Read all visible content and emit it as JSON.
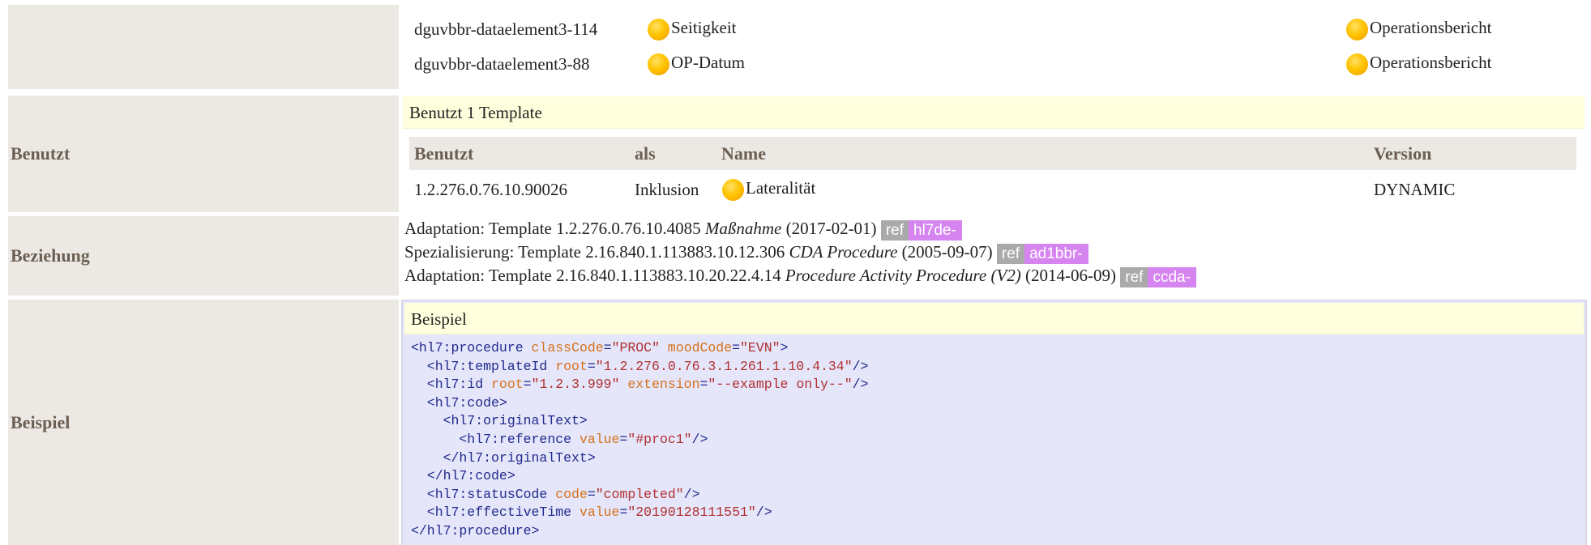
{
  "top_rows": [
    {
      "id": "dguvbbr-dataelement3-114",
      "name": "Seitigkeit",
      "source": "Operationsbericht"
    },
    {
      "id": "dguvbbr-dataelement3-88",
      "name": "OP-Datum",
      "source": "Operationsbericht"
    }
  ],
  "benutzt": {
    "label": "Benutzt",
    "header": "Benutzt 1 Template",
    "columns": [
      "Benutzt",
      "als",
      "Name",
      "Version"
    ],
    "row": {
      "id": "1.2.276.0.76.10.90026",
      "als": "Inklusion",
      "name": "Lateralität",
      "version": "DYNAMIC"
    }
  },
  "beziehung": {
    "label": "Beziehung",
    "items": [
      {
        "prefix": "Adaptation: Template 1.2.276.0.76.10.4085",
        "name": "Maßnahme",
        "date": "(2017-02-01)",
        "ref": "ref",
        "tag": "hl7de-"
      },
      {
        "prefix": "Spezialisierung: Template 2.16.840.1.113883.10.12.306",
        "name": "CDA Procedure",
        "date": "(2005-09-07)",
        "ref": "ref",
        "tag": "ad1bbr-"
      },
      {
        "prefix": "Adaptation: Template 2.16.840.1.113883.10.20.22.4.14",
        "name": "Procedure Activity Procedure (V2)",
        "date": "(2014-06-09)",
        "ref": "ref",
        "tag": "ccda-"
      }
    ]
  },
  "beispiel": {
    "label": "Beispiel",
    "header": "Beispiel",
    "lines": [
      "<hl7:procedure classCode=\"PROC\" moodCode=\"EVN\">",
      "  <hl7:templateId root=\"1.2.276.0.76.3.1.261.1.10.4.34\"/>",
      "  <hl7:id root=\"1.2.3.999\" extension=\"--example only--\"/>",
      "  <hl7:code>",
      "    <hl7:originalText>",
      "      <hl7:reference value=\"#proc1\"/>",
      "    </hl7:originalText>",
      "  </hl7:code>",
      "  <hl7:statusCode code=\"completed\"/>",
      "  <hl7:effectiveTime value=\"20190128111551\"/>",
      "</hl7:procedure>"
    ]
  },
  "colors": {
    "label_bg": "#ECE9E4",
    "header_yellow": "#FFFFDD",
    "code_bg": "#E6E6FA",
    "ref_grey": "#AAAAAA",
    "ref_purple": "#D685F0"
  }
}
